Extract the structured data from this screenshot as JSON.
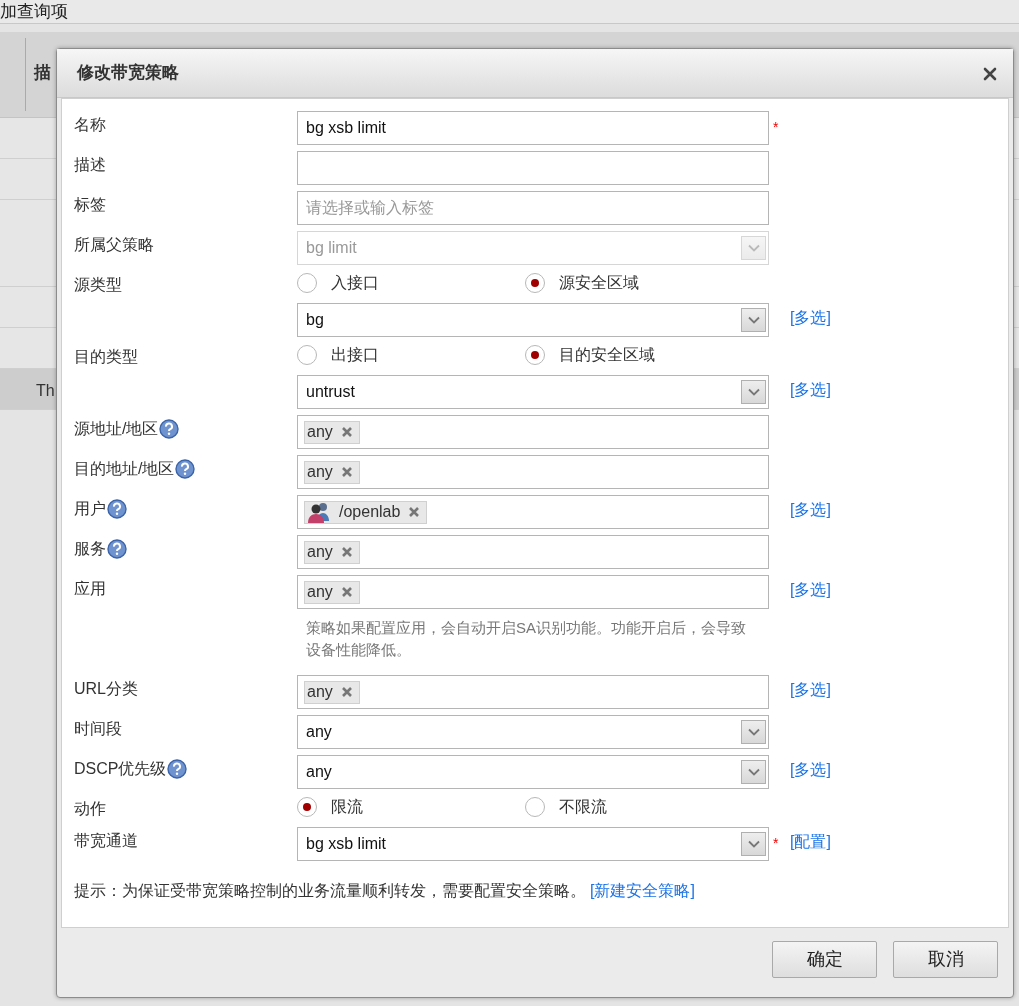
{
  "background": {
    "title": "加查询项",
    "header_cell": "描",
    "row_text": "Th"
  },
  "dialog": {
    "title": "修改带宽策略",
    "rows": [
      {
        "kind": "text",
        "label": "名称",
        "value": "bg xsb limit",
        "required_mark": "*"
      },
      {
        "kind": "text",
        "label": "描述"
      },
      {
        "kind": "text",
        "label": "标签",
        "placeholder": "请选择或输入标签"
      },
      {
        "kind": "select",
        "label": "所属父策略",
        "value": "bg limit",
        "disabled": true
      },
      {
        "kind": "radio",
        "label": "源类型",
        "options": [
          {
            "label": "入接口",
            "selected": false
          },
          {
            "label": "源安全区域",
            "selected": true
          }
        ]
      },
      {
        "kind": "select",
        "value": "bg",
        "link": "[多选]"
      },
      {
        "kind": "radio",
        "label": "目的类型",
        "options": [
          {
            "label": "出接口",
            "selected": false
          },
          {
            "label": "目的安全区域",
            "selected": true
          }
        ]
      },
      {
        "kind": "select",
        "value": "untrust",
        "link": "[多选]"
      },
      {
        "kind": "tags",
        "label": "源地址/地区",
        "help": true,
        "tags": [
          {
            "text": "any"
          }
        ]
      },
      {
        "kind": "tags",
        "label": "目的地址/地区",
        "help": true,
        "tags": [
          {
            "text": "any"
          }
        ]
      },
      {
        "kind": "tags",
        "label": "用户",
        "help": true,
        "tags": [
          {
            "text": "/openlab",
            "kind": "user"
          }
        ],
        "link": "[多选]"
      },
      {
        "kind": "tags",
        "label": "服务",
        "help": true,
        "tags": [
          {
            "text": "any"
          }
        ]
      },
      {
        "kind": "tags",
        "label": "应用",
        "tags": [
          {
            "text": "any"
          }
        ],
        "link": "[多选]"
      },
      {
        "kind": "note",
        "text": "策略如果配置应用，会自动开启SA识别功能。功能开启后，会导致设备性能降低。"
      },
      {
        "kind": "tags",
        "label": "URL分类",
        "tags": [
          {
            "text": "any"
          }
        ],
        "link": "[多选]"
      },
      {
        "kind": "select",
        "label": "时间段",
        "value": "any"
      },
      {
        "kind": "select",
        "label": "DSCP优先级",
        "help": true,
        "value": "any",
        "link": "[多选]"
      },
      {
        "kind": "radio",
        "label": "动作",
        "options": [
          {
            "label": "限流",
            "selected": true
          },
          {
            "label": "不限流",
            "selected": false
          }
        ]
      },
      {
        "kind": "select",
        "label": "带宽通道",
        "value": "bg xsb limit",
        "required_mark": "*",
        "link": "[配置]"
      }
    ],
    "hint": {
      "text": "提示：为保证受带宽策略控制的业务流量顺利转发，需要配置安全策略。",
      "link": "[新建安全策略]"
    },
    "buttons": [
      "确定",
      "取消"
    ]
  }
}
